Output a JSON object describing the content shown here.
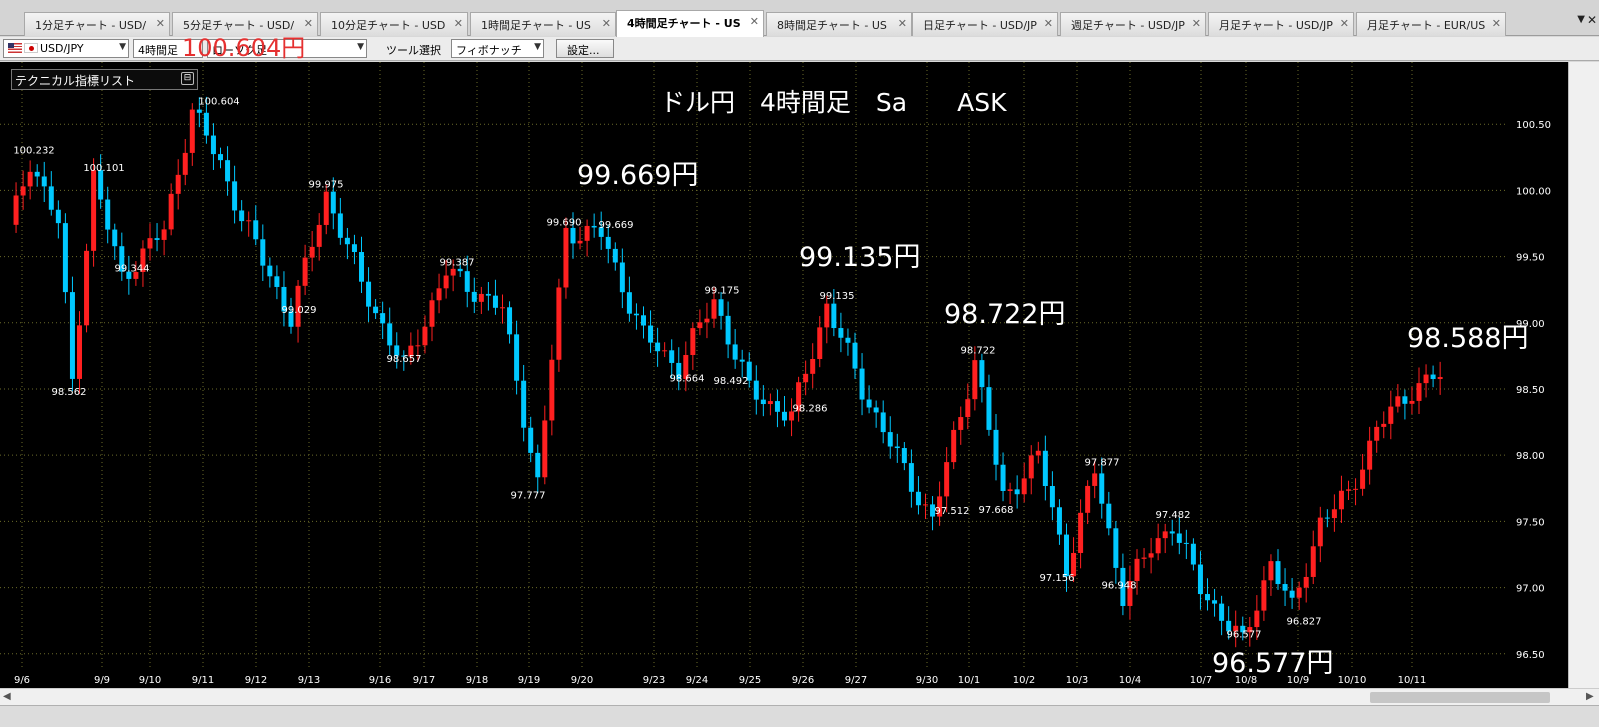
{
  "tabs": [
    {
      "label": "1分足チャート - USD/",
      "x": 0
    },
    {
      "label": "5分足チャート - USD/",
      "x": 0
    },
    {
      "label": "10分足チャート - USD",
      "x": 0
    },
    {
      "label": "1時間足チャート - US",
      "x": 0
    },
    {
      "label": "4時間足チャート - US",
      "x": 0
    },
    {
      "label": "8時間足チャート - US",
      "x": 0
    },
    {
      "label": "日足チャート - USD/JP",
      "x": 0
    },
    {
      "label": "週足チャート - USD/JP",
      "x": 0
    },
    {
      "label": "月足チャート - USD/JP",
      "x": 0
    },
    {
      "label": "月足チャート - EUR/US",
      "x": 0
    }
  ],
  "toolbar": {
    "pair": "USD/JPY",
    "timeframe_label": "4時間足",
    "chart_type": "ローソク足",
    "tool_label": "ツール選択",
    "tool_value": "フィボナッチ",
    "settings_button": "設定..."
  },
  "overlay_top": "100.604円",
  "panel": {
    "label": "テクニカル指標リスト"
  },
  "chart_title": "ドル円　4時間足　Sa　　ASK",
  "annotations_large": [
    {
      "text": "99.669円"
    },
    {
      "text": "99.135円"
    },
    {
      "text": "98.722円"
    },
    {
      "text": "98.588円"
    },
    {
      "text": "96.577円"
    }
  ],
  "colors": {
    "background": "#000000",
    "up": "#ff2020",
    "down": "#00c8ff",
    "grid": "#6b6b2a",
    "text": "#ffffff"
  },
  "chart_data": {
    "type": "candlestick",
    "title": "ドル円　4時間足　Sa　　ASK",
    "y_ticks": [
      "100.50",
      "100.00",
      "99.50",
      "99.00",
      "98.50",
      "98.00",
      "97.50",
      "97.00",
      "96.50"
    ],
    "ylim": [
      96.4,
      100.97
    ],
    "x_tick_labels": [
      "9/6",
      "9/9",
      "9/10",
      "9/11",
      "9/12",
      "9/13",
      "9/16",
      "9/17",
      "9/18",
      "9/19",
      "9/20",
      "9/23",
      "9/24",
      "9/25",
      "9/26",
      "9/27",
      "9/30",
      "10/1",
      "10/2",
      "10/3",
      "10/4",
      "10/7",
      "10/8",
      "10/9",
      "10/10",
      "10/11"
    ],
    "price_labels": [
      {
        "text": "100.232",
        "value": 100.232
      },
      {
        "text": "100.101",
        "value": 100.101
      },
      {
        "text": "100.604",
        "value": 100.604
      },
      {
        "text": "99.975",
        "value": 99.975
      },
      {
        "text": "99.344",
        "value": 99.344
      },
      {
        "text": "98.562",
        "value": 98.562
      },
      {
        "text": "99.029",
        "value": 99.029
      },
      {
        "text": "99.387",
        "value": 99.387
      },
      {
        "text": "98.657",
        "value": 98.657
      },
      {
        "text": "99.690",
        "value": 99.69
      },
      {
        "text": "99.669",
        "value": 99.669
      },
      {
        "text": "97.777",
        "value": 97.777
      },
      {
        "text": "99.175",
        "value": 99.175
      },
      {
        "text": "98.664",
        "value": 98.664
      },
      {
        "text": "98.492",
        "value": 98.492
      },
      {
        "text": "99.135",
        "value": 99.135
      },
      {
        "text": "98.286",
        "value": 98.286
      },
      {
        "text": "98.722",
        "value": 98.722
      },
      {
        "text": "97.512",
        "value": 97.512
      },
      {
        "text": "97.668",
        "value": 97.668
      },
      {
        "text": "97.877",
        "value": 97.877
      },
      {
        "text": "97.156",
        "value": 97.156
      },
      {
        "text": "96.948",
        "value": 96.948
      },
      {
        "text": "97.482",
        "value": 97.482
      },
      {
        "text": "96.577",
        "value": 96.577
      },
      {
        "text": "96.827",
        "value": 96.827
      }
    ],
    "anchors": [
      [
        0,
        99.7
      ],
      [
        3,
        100.232
      ],
      [
        7,
        99.75
      ],
      [
        9,
        98.562
      ],
      [
        12,
        100.101
      ],
      [
        16,
        99.344
      ],
      [
        22,
        99.7
      ],
      [
        26,
        100.604
      ],
      [
        30,
        100.2
      ],
      [
        33,
        99.8
      ],
      [
        40,
        99.029
      ],
      [
        45,
        99.975
      ],
      [
        50,
        99.3
      ],
      [
        56,
        98.657
      ],
      [
        62,
        99.387
      ],
      [
        70,
        99.1
      ],
      [
        75,
        97.777
      ],
      [
        79,
        99.69
      ],
      [
        84,
        99.669
      ],
      [
        90,
        98.9
      ],
      [
        95,
        98.664
      ],
      [
        100,
        99.175
      ],
      [
        105,
        98.492
      ],
      [
        111,
        98.286
      ],
      [
        116,
        99.135
      ],
      [
        121,
        98.5
      ],
      [
        127,
        97.88
      ],
      [
        131,
        97.512
      ],
      [
        137,
        98.722
      ],
      [
        141,
        97.668
      ],
      [
        146,
        98.0
      ],
      [
        150,
        97.156
      ],
      [
        154,
        97.877
      ],
      [
        158,
        96.948
      ],
      [
        162,
        97.3
      ],
      [
        165,
        97.482
      ],
      [
        169,
        97.0
      ],
      [
        175,
        96.577
      ],
      [
        179,
        97.2
      ],
      [
        182,
        96.827
      ],
      [
        186,
        97.5
      ],
      [
        190,
        97.7
      ],
      [
        194,
        98.2
      ],
      [
        199,
        98.5
      ],
      [
        202,
        98.588
      ]
    ]
  }
}
